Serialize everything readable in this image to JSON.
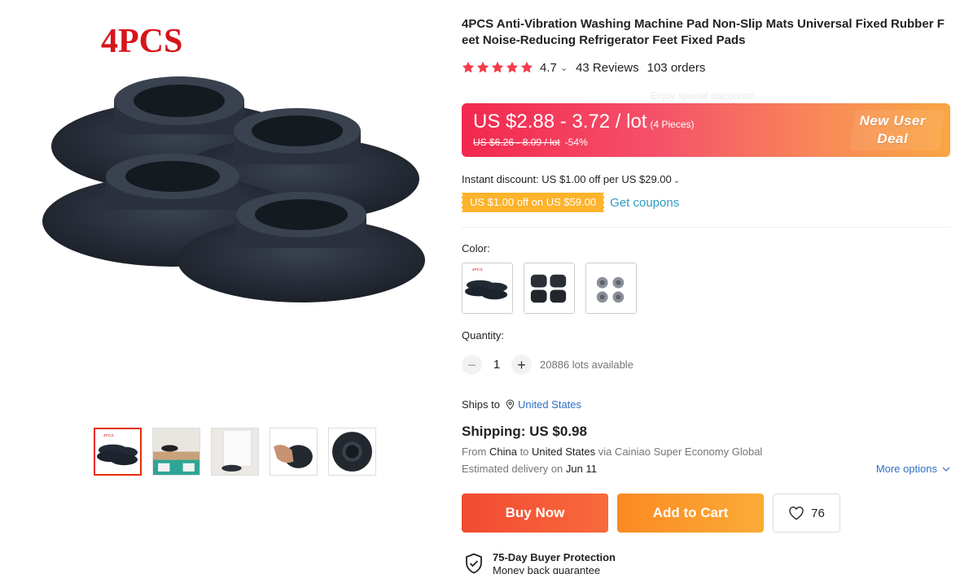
{
  "gallery": {
    "overlay_text": "4PCS",
    "thumbnail_count": 5
  },
  "product": {
    "title": "4PCS Anti-Vibration Washing Machine Pad Non-Slip Mats Universal Fixed Rubber Feet Noise-Reducing Refrigerator Feet Fixed Pads",
    "rating": "4.7",
    "rating_stars": 5,
    "reviews": "43 Reviews",
    "orders": "103 orders",
    "faint_text": "Enjoy special discounts!"
  },
  "price": {
    "current": "US $2.88 - 3.72 / lot",
    "unit_note": "(4 Pieces)",
    "original": "US $6.26 - 8.09 / lot",
    "discount": "-54%",
    "deal_line1": "New User",
    "deal_line2": "Deal",
    "gradient_start": "#f2284f",
    "gradient_end": "#f9a642"
  },
  "promo": {
    "instant_discount": "Instant discount: US $1.00 off per US $29.00",
    "coupon": "US $1.00 off on US $59.00",
    "get_coupons": "Get coupons"
  },
  "options": {
    "color_label": "Color:",
    "quantity_label": "Quantity:",
    "quantity_value": "1",
    "minus": "−",
    "plus": "+",
    "available": "20886 lots available"
  },
  "shipping": {
    "ships_to_label": "Ships to",
    "ships_to_country": "United States",
    "price": "Shipping: US $0.98",
    "from_prefix": "From",
    "from_country": "China",
    "to_word": "to",
    "to_country": "United States",
    "via": "via Cainiao Super Economy Global",
    "delivery_prefix": "Estimated delivery on",
    "delivery_date": "Jun 11",
    "more_options": "More options"
  },
  "actions": {
    "buy_now": "Buy Now",
    "add_to_cart": "Add to Cart",
    "wishlist_count": "76",
    "buy_color": "#f24a31",
    "cart_color": "#fb8a23"
  },
  "protection": {
    "title": "75-Day Buyer Protection",
    "subtitle": "Money back guarantee"
  }
}
